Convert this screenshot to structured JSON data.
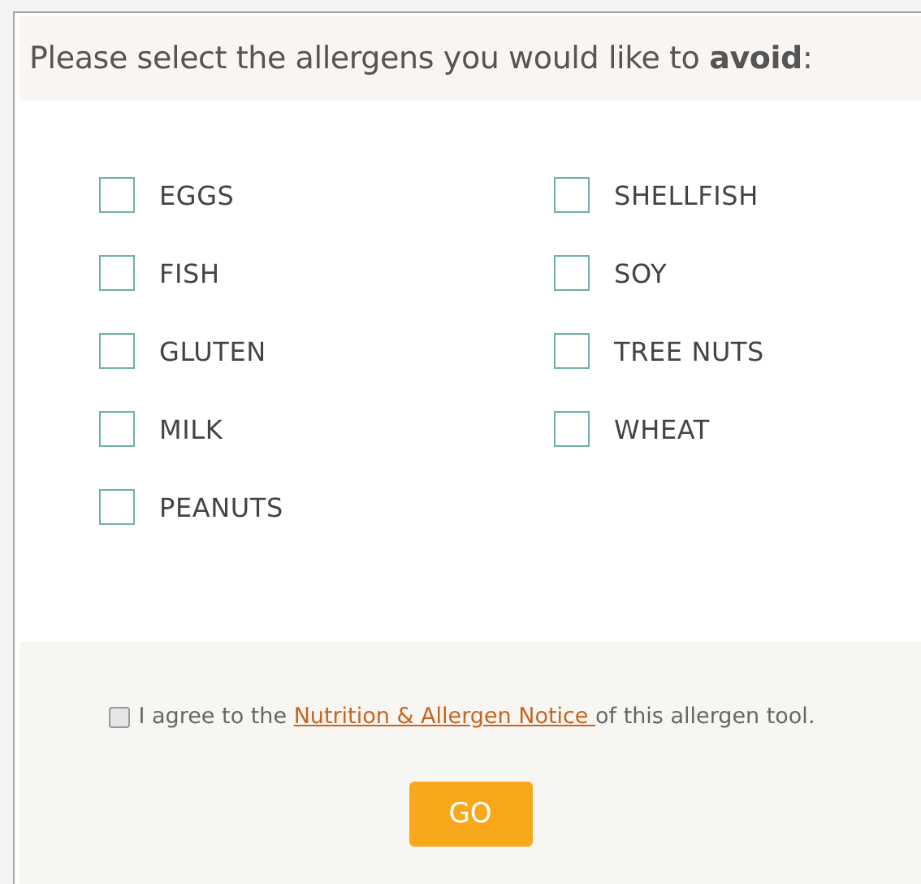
{
  "heading": "Please select the allergens you would like to **avoid**:",
  "allergens": [
    {
      "label": "EGGS",
      "checked": false
    },
    {
      "label": "FISH",
      "checked": false
    },
    {
      "label": "GLUTEN",
      "checked": false
    },
    {
      "label": "MILK",
      "checked": false
    },
    {
      "label": "PEANUTS",
      "checked": false
    },
    {
      "label": "SHELLFISH",
      "checked": false
    },
    {
      "label": "SOY",
      "checked": false
    },
    {
      "label": "TREE NUTS",
      "checked": false
    },
    {
      "label": "WHEAT",
      "checked": false
    }
  ],
  "agreement": {
    "checked": false,
    "before": "I agree to the ",
    "link": "Nutrition & Allergen Notice ",
    "after": "of this allergen tool."
  },
  "submit": "GO"
}
